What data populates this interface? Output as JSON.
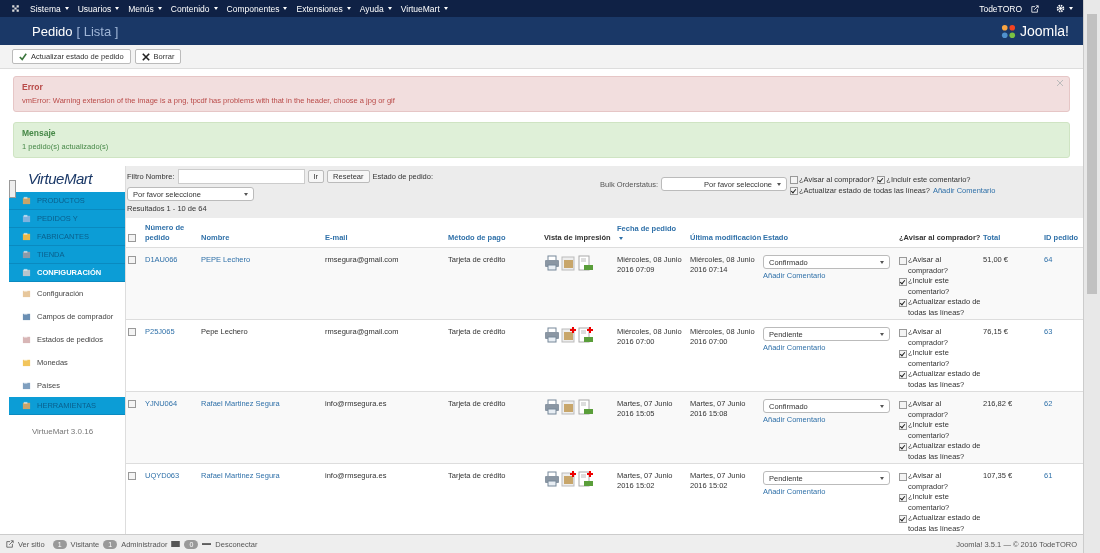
{
  "top_menu": [
    {
      "label": "Sistema",
      "caret": true
    },
    {
      "label": "Usuarios",
      "caret": true
    },
    {
      "label": "Menús",
      "caret": true
    },
    {
      "label": "Contenido",
      "caret": true
    },
    {
      "label": "Componentes",
      "caret": true
    },
    {
      "label": "Extensiones",
      "caret": true
    },
    {
      "label": "Ayuda",
      "caret": true
    },
    {
      "label": "VirtueMart",
      "caret": true
    }
  ],
  "top_user": "TodeTORO",
  "header": {
    "title": "Pedido",
    "subtitle": "[ Lista ]",
    "logo": "Joomla!"
  },
  "toolbar": [
    {
      "label": "Actualizar estado de pedido",
      "kind": "check"
    },
    {
      "label": "Borrar",
      "kind": "delete"
    }
  ],
  "alerts": [
    {
      "kind": "error",
      "title": "Error",
      "text": "vmError: Warning extension of the image is a png, tpcdf has problems with that in the header, choose a jpg or gif",
      "closable": true
    },
    {
      "kind": "success",
      "title": "Mensaje",
      "text": "1 pedido(s) actualizado(s)",
      "closable": false
    }
  ],
  "sidebar": {
    "logo": "VirtueMart",
    "items": [
      {
        "label": "PRODUCTOS",
        "kind": "section",
        "selected": false
      },
      {
        "label": "PEDIDOS Y",
        "kind": "section",
        "selected": false
      },
      {
        "label": "FABRICANTES",
        "kind": "section",
        "selected": false
      },
      {
        "label": "TIENDA",
        "kind": "section",
        "selected": false
      },
      {
        "label": "CONFIGURACIÓN",
        "kind": "section",
        "selected": true
      },
      {
        "label": "Configuración",
        "kind": "link",
        "selected": false
      },
      {
        "label": "Campos de comprador",
        "kind": "link",
        "selected": false
      },
      {
        "label": "Estados de pedidos",
        "kind": "link",
        "selected": false
      },
      {
        "label": "Monedas",
        "kind": "link",
        "selected": false
      },
      {
        "label": "Países",
        "kind": "link",
        "selected": false
      },
      {
        "label": "HERRAMIENTAS",
        "kind": "section",
        "selected": false
      }
    ],
    "version": "VirtueMart 3.0.16"
  },
  "filter": {
    "label": "Filtro Nombre:",
    "go": "Ir",
    "reset": "Resetear",
    "status_label": "Estado de pedido:",
    "status_select": "Por favor seleccione",
    "results": "Resultados 1 - 10 de 64"
  },
  "bulk": {
    "label": "Bulk Orderstatus:",
    "select": "Por favor seleccione",
    "options": [
      {
        "label": "¿Avisar al comprador?",
        "checked": false
      },
      {
        "label": "¿Incluir este comentario?",
        "checked": true
      },
      {
        "label": "¿Actualizar estado de todas las líneas?",
        "checked": true
      }
    ],
    "link": "Añadir Comentario"
  },
  "select_all": {
    "checked": false
  },
  "columns": [
    {
      "label": "Número de pedido",
      "sortable": true
    },
    {
      "label": "Nombre",
      "sortable": true
    },
    {
      "label": "E-mail",
      "sortable": true
    },
    {
      "label": "Método de pago",
      "sortable": true
    },
    {
      "label": "Vista de impresión",
      "sortable": false
    },
    {
      "label": "Fecha de pedido",
      "sortable": true
    },
    {
      "label": "Última modificación",
      "sortable": true
    },
    {
      "label": "Estado",
      "sortable": true
    },
    {
      "label": "¿Avisar al comprador?",
      "sortable": false
    },
    {
      "label": "Total",
      "sortable": true
    },
    {
      "label": "ID pedido",
      "sortable": true
    }
  ],
  "rows": [
    {
      "checked": false,
      "number": "D1AU066",
      "name": "PEPE Lechero",
      "name_link": true,
      "email": "rmsegura@gmail.com",
      "payment": "Tarjeta de crédito",
      "new_docs": false,
      "created": "Miércoles, 08 Junio 2016 07:09",
      "modified": "Miércoles, 08 Junio 2016 07:14",
      "status": "Confirmado",
      "comment": "Añadir Comentario",
      "notify": [
        {
          "label": "¿Avisar al comprador?",
          "checked": false
        },
        {
          "label": "¿Incluir este comentario?",
          "checked": true
        },
        {
          "label": "¿Actualizar estado de todas las líneas?",
          "checked": true
        }
      ],
      "total": "51,00 €",
      "id": "64"
    },
    {
      "checked": false,
      "number": "P25J065",
      "name": "Pepe Lechero",
      "name_link": false,
      "email": "rmsegura@gmail.com",
      "payment": "Tarjeta de crédito",
      "new_docs": true,
      "created": "Miércoles, 08 Junio 2016 07:00",
      "modified": "Miércoles, 08 Junio 2016 07:00",
      "status": "Pendiente",
      "comment": "Añadir Comentario",
      "notify": [
        {
          "label": "¿Avisar al comprador?",
          "checked": false
        },
        {
          "label": "¿Incluir este comentario?",
          "checked": true
        },
        {
          "label": "¿Actualizar estado de todas las líneas?",
          "checked": true
        }
      ],
      "total": "76,15 €",
      "id": "63"
    },
    {
      "checked": false,
      "number": "YJNU064",
      "name": "Rafael Martinez Segura",
      "name_link": true,
      "email": "info@rmsegura.es",
      "payment": "Tarjeta de crédito",
      "new_docs": false,
      "created": "Martes, 07 Junio 2016 15:05",
      "modified": "Martes, 07 Junio 2016 15:08",
      "status": "Confirmado",
      "comment": "Añadir Comentario",
      "notify": [
        {
          "label": "¿Avisar al comprador?",
          "checked": false
        },
        {
          "label": "¿Incluir este comentario?",
          "checked": true
        },
        {
          "label": "¿Actualizar estado de todas las líneas?",
          "checked": true
        }
      ],
      "total": "216,82 €",
      "id": "62"
    },
    {
      "checked": false,
      "number": "UQYD063",
      "name": "Rafael Martinez Segura",
      "name_link": true,
      "email": "info@rmsegura.es",
      "payment": "Tarjeta de crédito",
      "new_docs": true,
      "created": "Martes, 07 Junio 2016 15:02",
      "modified": "Martes, 07 Junio 2016 15:02",
      "status": "Pendiente",
      "comment": "Añadir Comentario",
      "notify": [
        {
          "label": "¿Avisar al comprador?",
          "checked": false
        },
        {
          "label": "¿Incluir este comentario?",
          "checked": true
        },
        {
          "label": "¿Actualizar estado de todas las líneas?",
          "checked": true
        }
      ],
      "total": "107,35 €",
      "id": "61"
    }
  ],
  "status_bar": {
    "view_site": "Ver sitio",
    "visitors_count": "1",
    "visitors": "Visitante",
    "admins_count": "1",
    "admins": "Administrador",
    "messages_count": "0",
    "logout": "Desconectar",
    "footer": "Joomla! 3.5.1 — © 2016 TodeTORO"
  }
}
